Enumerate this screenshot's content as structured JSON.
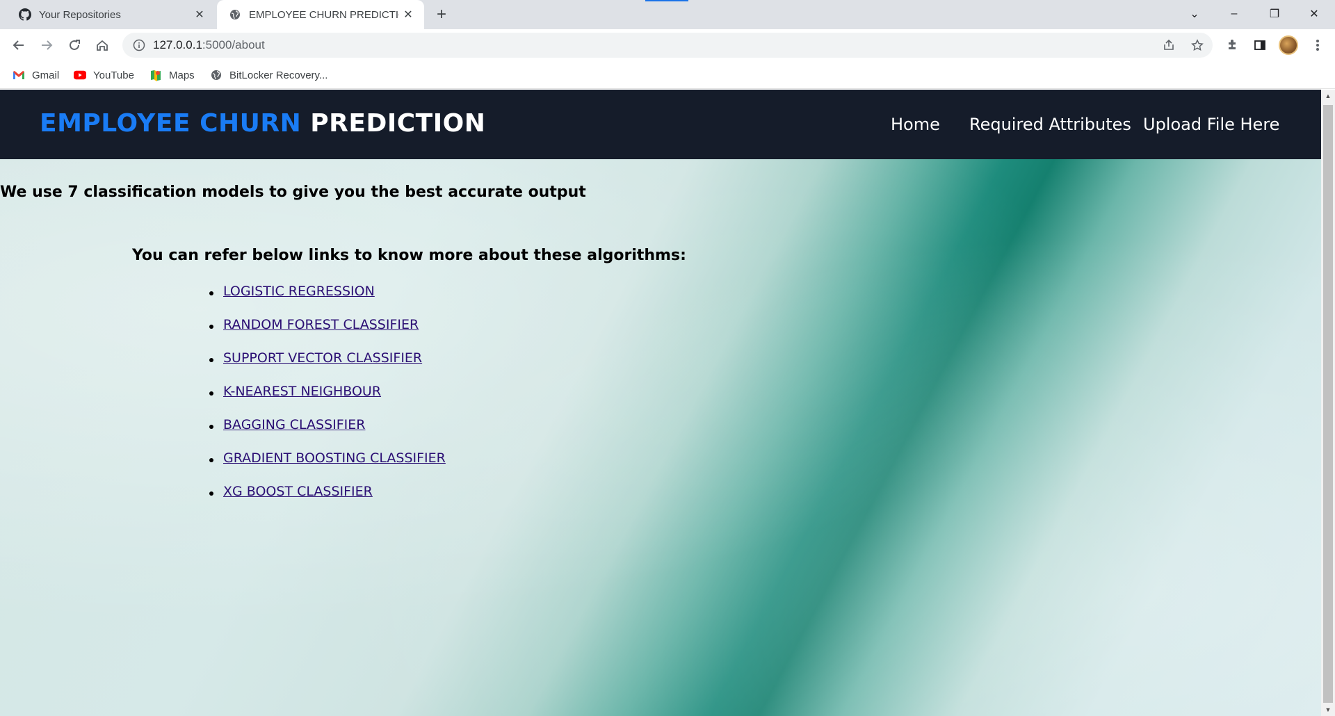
{
  "browser": {
    "tabs": [
      {
        "title": "Your Repositories",
        "icon": "github-icon",
        "active": false
      },
      {
        "title": "EMPLOYEE CHURN PREDICTION",
        "icon": "globe-icon",
        "active": true
      }
    ],
    "url_host": "127.0.0.1",
    "url_path": ":5000/about",
    "bookmarks": [
      {
        "label": "Gmail",
        "icon": "gmail-icon"
      },
      {
        "label": "YouTube",
        "icon": "youtube-icon"
      },
      {
        "label": "Maps",
        "icon": "maps-icon"
      },
      {
        "label": "BitLocker Recovery...",
        "icon": "globe-icon"
      }
    ]
  },
  "site": {
    "brand_part1": "EMPLOYEE CHURN",
    "brand_part2": "PREDICTION",
    "nav": [
      {
        "label": "Home"
      },
      {
        "label": "Required Attributes"
      },
      {
        "label": "Upload File Here"
      }
    ]
  },
  "content": {
    "lead": "We use 7 classification models to give you the best accurate output",
    "refer": "You can refer below links to know more about these algorithms:",
    "algorithms": [
      "LOGISTIC REGRESSION",
      "RANDOM FOREST CLASSIFIER",
      "SUPPORT VECTOR CLASSIFIER",
      "K-NEAREST NEIGHBOUR",
      "BAGGING CLASSIFIER",
      "GRADIENT BOOSTING CLASSIFIER",
      "XG BOOST CLASSIFIER"
    ]
  },
  "colors": {
    "header_bg": "#151c2a",
    "brand_accent": "#1a7cf5",
    "link": "#2b0f74"
  }
}
